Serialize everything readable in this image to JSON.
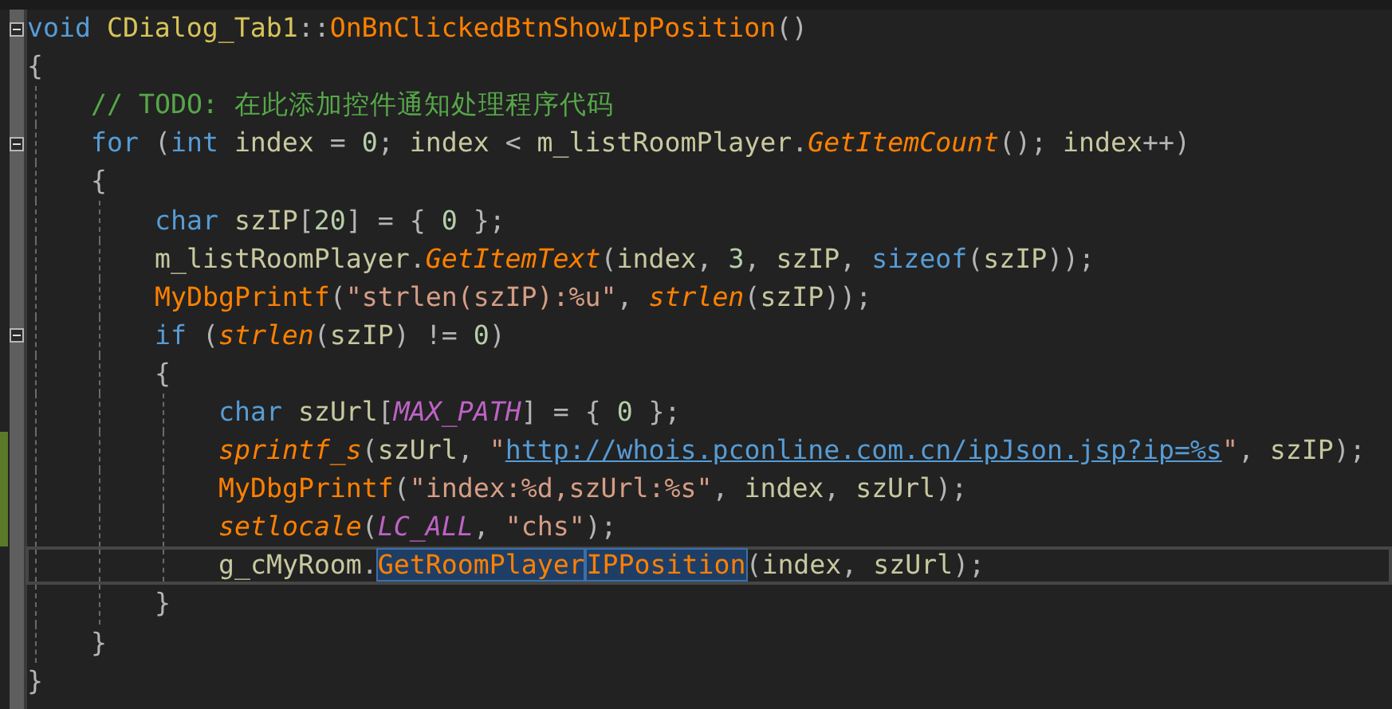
{
  "editor": {
    "lines": [
      {
        "fold": true,
        "changed": false,
        "current": false,
        "tokens": [
          {
            "t": "void",
            "kind": "keyword"
          },
          {
            "t": " CDialog_Tab1",
            "kind": "type"
          },
          {
            "t": "::",
            "kind": "punct"
          },
          {
            "t": "OnBnClickedBtnShowIpPosition",
            "kind": "func"
          },
          {
            "t": "()",
            "kind": "punct"
          }
        ]
      },
      {
        "fold": false,
        "changed": false,
        "current": false,
        "tokens": [
          {
            "t": "{",
            "kind": "punct"
          }
        ],
        "children": [
          {
            "fold": false,
            "changed": false,
            "current": false,
            "tokens": [
              {
                "t": "// TODO: 在此添加控件通知处理程序代码",
                "kind": "comment"
              }
            ]
          },
          {
            "fold": true,
            "changed": false,
            "current": false,
            "tokens": [
              {
                "t": "for",
                "kind": "keyword"
              },
              {
                "t": " (",
                "kind": "punct"
              },
              {
                "t": "int",
                "kind": "keyword"
              },
              {
                "t": " index ",
                "kind": "ident"
              },
              {
                "t": "= ",
                "kind": "punct"
              },
              {
                "t": "0",
                "kind": "number"
              },
              {
                "t": "; ",
                "kind": "punct"
              },
              {
                "t": "index ",
                "kind": "ident"
              },
              {
                "t": "< ",
                "kind": "punct"
              },
              {
                "t": "m_listRoomPlayer",
                "kind": "ident"
              },
              {
                "t": ".",
                "kind": "punct"
              },
              {
                "t": "GetItemCount",
                "kind": "method"
              },
              {
                "t": "(); ",
                "kind": "punct"
              },
              {
                "t": "index",
                "kind": "ident"
              },
              {
                "t": "++)",
                "kind": "punct"
              }
            ]
          },
          {
            "fold": false,
            "changed": false,
            "current": false,
            "tokens": [
              {
                "t": "{",
                "kind": "punct"
              }
            ],
            "children": [
              {
                "fold": false,
                "changed": false,
                "current": false,
                "tokens": [
                  {
                    "t": "char",
                    "kind": "keyword"
                  },
                  {
                    "t": " szIP",
                    "kind": "ident"
                  },
                  {
                    "t": "[",
                    "kind": "punct"
                  },
                  {
                    "t": "20",
                    "kind": "number"
                  },
                  {
                    "t": "] = { ",
                    "kind": "punct"
                  },
                  {
                    "t": "0",
                    "kind": "number"
                  },
                  {
                    "t": " };",
                    "kind": "punct"
                  }
                ]
              },
              {
                "fold": false,
                "changed": false,
                "current": false,
                "tokens": [
                  {
                    "t": "m_listRoomPlayer",
                    "kind": "ident"
                  },
                  {
                    "t": ".",
                    "kind": "punct"
                  },
                  {
                    "t": "GetItemText",
                    "kind": "method"
                  },
                  {
                    "t": "(",
                    "kind": "punct"
                  },
                  {
                    "t": "index",
                    "kind": "ident"
                  },
                  {
                    "t": ", ",
                    "kind": "punct"
                  },
                  {
                    "t": "3",
                    "kind": "number"
                  },
                  {
                    "t": ", ",
                    "kind": "punct"
                  },
                  {
                    "t": "szIP",
                    "kind": "ident"
                  },
                  {
                    "t": ", ",
                    "kind": "punct"
                  },
                  {
                    "t": "sizeof",
                    "kind": "keyword"
                  },
                  {
                    "t": "(",
                    "kind": "punct"
                  },
                  {
                    "t": "szIP",
                    "kind": "ident"
                  },
                  {
                    "t": "));",
                    "kind": "punct"
                  }
                ]
              },
              {
                "fold": false,
                "changed": false,
                "current": false,
                "tokens": [
                  {
                    "t": "MyDbgPrintf",
                    "kind": "func"
                  },
                  {
                    "t": "(",
                    "kind": "punct"
                  },
                  {
                    "t": "\"strlen(szIP):%u\"",
                    "kind": "string"
                  },
                  {
                    "t": ", ",
                    "kind": "punct"
                  },
                  {
                    "t": "strlen",
                    "kind": "method"
                  },
                  {
                    "t": "(",
                    "kind": "punct"
                  },
                  {
                    "t": "szIP",
                    "kind": "ident"
                  },
                  {
                    "t": "));",
                    "kind": "punct"
                  }
                ]
              },
              {
                "fold": true,
                "changed": false,
                "current": false,
                "tokens": [
                  {
                    "t": "if",
                    "kind": "keyword"
                  },
                  {
                    "t": " (",
                    "kind": "punct"
                  },
                  {
                    "t": "strlen",
                    "kind": "method"
                  },
                  {
                    "t": "(",
                    "kind": "punct"
                  },
                  {
                    "t": "szIP",
                    "kind": "ident"
                  },
                  {
                    "t": ") != ",
                    "kind": "punct"
                  },
                  {
                    "t": "0",
                    "kind": "number"
                  },
                  {
                    "t": ")",
                    "kind": "punct"
                  }
                ]
              },
              {
                "fold": false,
                "changed": false,
                "current": false,
                "tokens": [
                  {
                    "t": "{",
                    "kind": "punct"
                  }
                ],
                "children": [
                  {
                    "fold": false,
                    "changed": false,
                    "current": false,
                    "tokens": [
                      {
                        "t": "char",
                        "kind": "keyword"
                      },
                      {
                        "t": " szUrl",
                        "kind": "ident"
                      },
                      {
                        "t": "[",
                        "kind": "punct"
                      },
                      {
                        "t": "MAX_PATH",
                        "kind": "macro"
                      },
                      {
                        "t": "] = { ",
                        "kind": "punct"
                      },
                      {
                        "t": "0",
                        "kind": "number"
                      },
                      {
                        "t": " };",
                        "kind": "punct"
                      }
                    ]
                  },
                  {
                    "fold": false,
                    "changed": true,
                    "current": false,
                    "tokens": [
                      {
                        "t": "sprintf_s",
                        "kind": "method"
                      },
                      {
                        "t": "(",
                        "kind": "punct"
                      },
                      {
                        "t": "szUrl",
                        "kind": "ident"
                      },
                      {
                        "t": ", ",
                        "kind": "punct"
                      },
                      {
                        "t": "\"",
                        "kind": "string"
                      },
                      {
                        "t": "http://whois.pconline.com.cn/ipJson.jsp?ip=%s",
                        "kind": "url"
                      },
                      {
                        "t": "\"",
                        "kind": "string"
                      },
                      {
                        "t": ", ",
                        "kind": "punct"
                      },
                      {
                        "t": "szIP",
                        "kind": "ident"
                      },
                      {
                        "t": ");",
                        "kind": "punct"
                      }
                    ]
                  },
                  {
                    "fold": false,
                    "changed": true,
                    "current": false,
                    "tokens": [
                      {
                        "t": "MyDbgPrintf",
                        "kind": "func"
                      },
                      {
                        "t": "(",
                        "kind": "punct"
                      },
                      {
                        "t": "\"index:%d,szUrl:%s\"",
                        "kind": "string"
                      },
                      {
                        "t": ", ",
                        "kind": "punct"
                      },
                      {
                        "t": "index",
                        "kind": "ident"
                      },
                      {
                        "t": ", ",
                        "kind": "punct"
                      },
                      {
                        "t": "szUrl",
                        "kind": "ident"
                      },
                      {
                        "t": ");",
                        "kind": "punct"
                      }
                    ]
                  },
                  {
                    "fold": false,
                    "changed": true,
                    "current": false,
                    "tokens": [
                      {
                        "t": "setlocale",
                        "kind": "method"
                      },
                      {
                        "t": "(",
                        "kind": "punct"
                      },
                      {
                        "t": "LC_ALL",
                        "kind": "macro"
                      },
                      {
                        "t": ", ",
                        "kind": "punct"
                      },
                      {
                        "t": "\"chs\"",
                        "kind": "string"
                      },
                      {
                        "t": ");",
                        "kind": "punct"
                      }
                    ]
                  },
                  {
                    "fold": false,
                    "changed": false,
                    "current": true,
                    "tokens": [
                      {
                        "t": "g_cMyRoom",
                        "kind": "ident"
                      },
                      {
                        "t": ".",
                        "kind": "punct"
                      },
                      {
                        "t": "GetRoomPlayer",
                        "kind": "func",
                        "selected": true,
                        "caret": false
                      },
                      {
                        "t": "IPPosition",
                        "kind": "func",
                        "selected": true,
                        "caret": true
                      },
                      {
                        "t": "(",
                        "kind": "punct"
                      },
                      {
                        "t": "index",
                        "kind": "ident"
                      },
                      {
                        "t": ", ",
                        "kind": "punct"
                      },
                      {
                        "t": "szUrl",
                        "kind": "ident"
                      },
                      {
                        "t": ");",
                        "kind": "punct"
                      }
                    ]
                  }
                ]
              },
              {
                "fold": false,
                "changed": false,
                "current": false,
                "tokens": [
                  {
                    "t": "}",
                    "kind": "punct"
                  }
                ]
              }
            ]
          },
          {
            "fold": false,
            "changed": false,
            "current": false,
            "tokens": [
              {
                "t": "}",
                "kind": "punct"
              }
            ]
          }
        ]
      },
      {
        "fold": false,
        "changed": false,
        "current": false,
        "tokens": [
          {
            "t": "}",
            "kind": "punct"
          }
        ]
      }
    ]
  }
}
